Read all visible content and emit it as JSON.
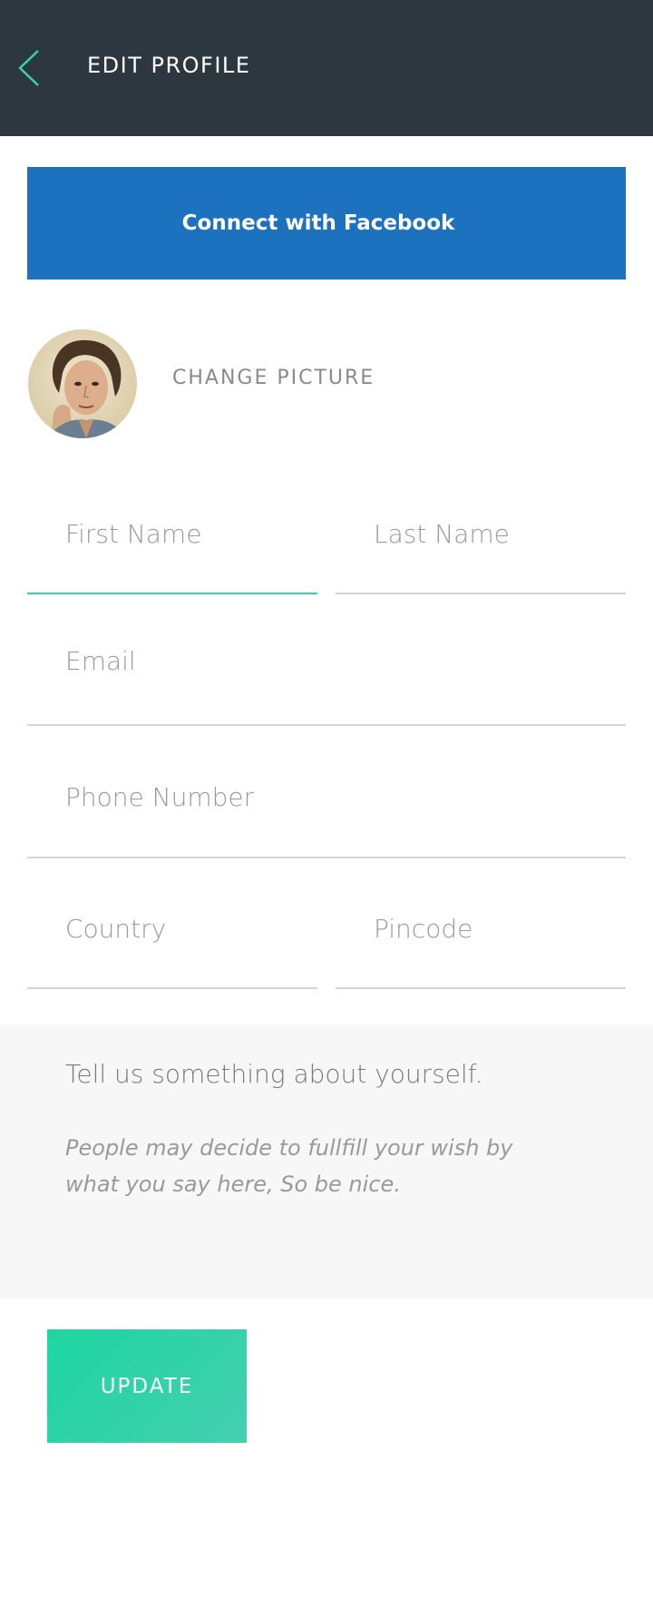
{
  "header": {
    "title": "EDIT PROFILE",
    "back_icon": "chevron-left-icon",
    "accent_color": "#3ad2aa",
    "background_color": "#2c3740"
  },
  "facebook": {
    "label": "Connect with Facebook",
    "color": "#1d72bf"
  },
  "profile": {
    "change_picture_label": "CHANGE PICTURE"
  },
  "form": {
    "first_name_placeholder": "First Name",
    "last_name_placeholder": "Last Name",
    "email_placeholder": "Email",
    "phone_placeholder": "Phone Number",
    "country_placeholder": "Country",
    "pincode_placeholder": "Pincode",
    "active_field": "first_name"
  },
  "about": {
    "placeholder": "Tell us something about yourself.",
    "hint": "People may decide to fullfill your wish by what you say here, So be nice."
  },
  "update": {
    "label": "UPDATE",
    "color": "#1dd6a2"
  }
}
